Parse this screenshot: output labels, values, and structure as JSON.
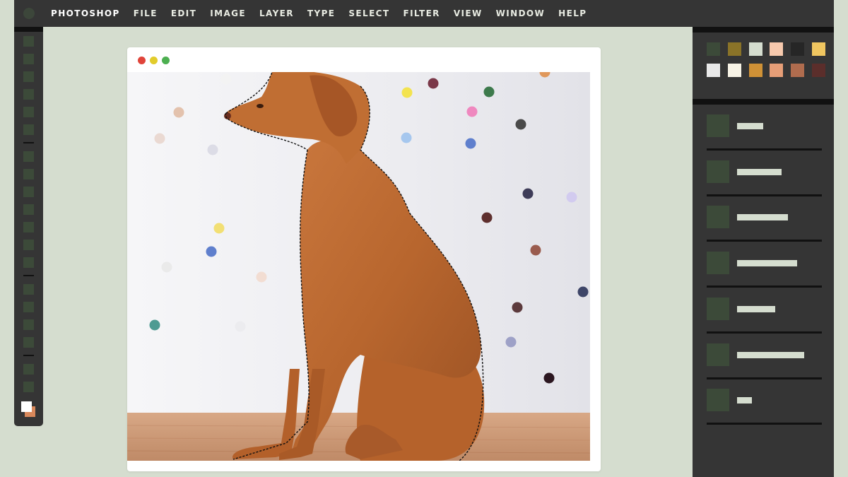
{
  "menubar": {
    "items": [
      "PHOTOSHOP",
      "FILE",
      "EDIT",
      "IMAGE",
      "LAYER",
      "TYPE",
      "SELECT",
      "FILTER",
      "VIEW",
      "WINDOW",
      "HELP"
    ]
  },
  "toolbar": {
    "tool_icon": "tool-square",
    "foreground_color": "#ffffff",
    "background_color": "#d8885b"
  },
  "document": {
    "window_buttons": [
      {
        "name": "close",
        "color": "#e0443a"
      },
      {
        "name": "minimize",
        "color": "#e2cc2b"
      },
      {
        "name": "maximize",
        "color": "#4caf50"
      }
    ],
    "image": "dog-photo-with-selection",
    "selection": "marching-ants-outline"
  },
  "swatches": {
    "colors": [
      "#3c4a39",
      "#8a7328",
      "#d5ddcf",
      "#f7c9ad",
      "#262626",
      "#f0c660",
      "#e9e9e9",
      "#f7f3e6",
      "#cf9136",
      "#e69e77",
      "#b06c4e",
      "#5b2e2b"
    ]
  },
  "layers": {
    "count": 7,
    "thumb_color": "#3c4a39",
    "name_placeholder_color": "#d5ddcf"
  },
  "colors": {
    "ui_dark": "#353535",
    "app_background": "#d5ddcf",
    "accent_green": "#3c4a39"
  }
}
